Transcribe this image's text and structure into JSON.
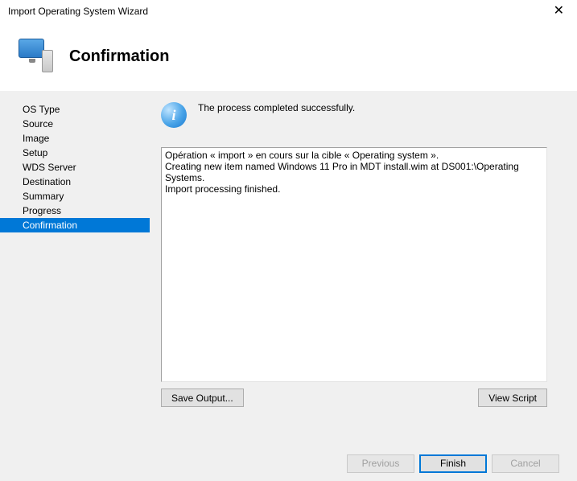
{
  "titlebar": {
    "title": "Import Operating System Wizard"
  },
  "header": {
    "title": "Confirmation"
  },
  "sidebar": {
    "items": [
      {
        "label": "OS Type"
      },
      {
        "label": "Source"
      },
      {
        "label": "Image"
      },
      {
        "label": "Setup"
      },
      {
        "label": "WDS Server"
      },
      {
        "label": "Destination"
      },
      {
        "label": "Summary"
      },
      {
        "label": "Progress"
      },
      {
        "label": "Confirmation"
      }
    ],
    "selectedIndex": 8
  },
  "content": {
    "status": "The process completed successfully.",
    "log": "Opération « import » en cours sur la cible « Operating system ».\nCreating new item named Windows 11 Pro in MDT install.wim at DS001:\\Operating Systems.\nImport processing finished.",
    "saveOutputLabel": "Save Output...",
    "viewScriptLabel": "View Script"
  },
  "footer": {
    "previous": "Previous",
    "finish": "Finish",
    "cancel": "Cancel"
  }
}
